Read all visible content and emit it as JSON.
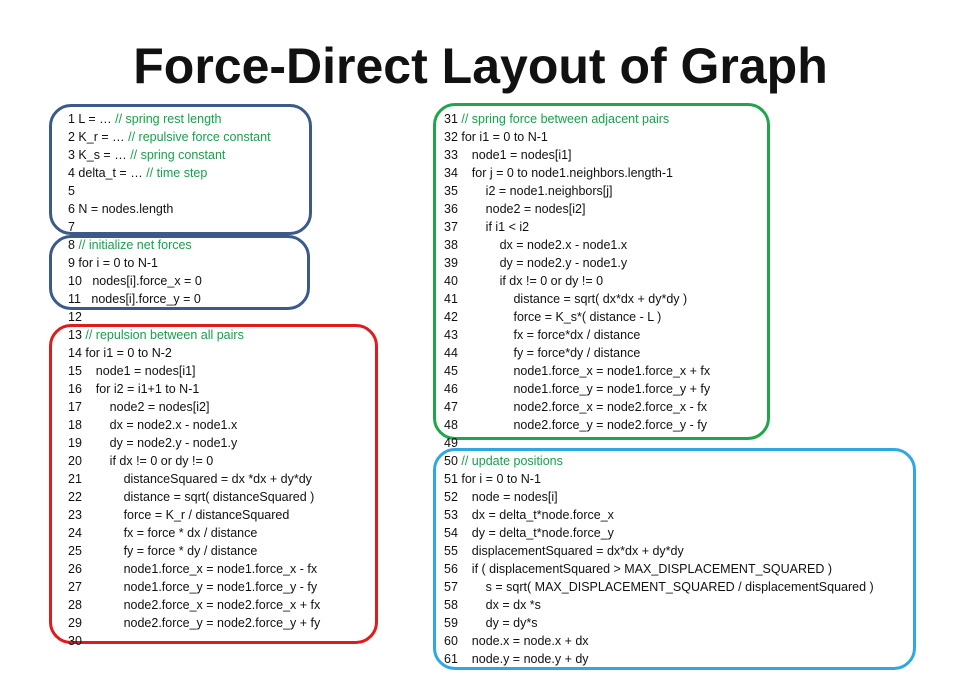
{
  "page": {
    "title": "Force-Direct Layout of Graph"
  },
  "colors": {
    "comment": "#1aa04a",
    "box_constants": "#3b5a8a",
    "box_init": "#3b5a8a",
    "box_repulsion": "#e01b1b",
    "box_spring": "#1fa54a",
    "box_update": "#2fa8df"
  },
  "left_column": {
    "lines": [
      {
        "code": "1 L = … ",
        "comment": "// spring rest length"
      },
      {
        "code": "2 K_r = … ",
        "comment": "// repulsive force constant"
      },
      {
        "code": "3 K_s = … ",
        "comment": "// spring constant"
      },
      {
        "code": "4 delta_t = … ",
        "comment": "// time step"
      },
      {
        "code": "5",
        "comment": ""
      },
      {
        "code": "6 N = nodes.length",
        "comment": ""
      },
      {
        "code": "7",
        "comment": ""
      },
      {
        "code": "8 ",
        "comment": "// initialize net forces"
      },
      {
        "code": "9 for i = 0 to N-1",
        "comment": ""
      },
      {
        "code": "10   nodes[i].force_x = 0",
        "comment": ""
      },
      {
        "code": "11   nodes[i].force_y = 0",
        "comment": ""
      },
      {
        "code": "12",
        "comment": ""
      },
      {
        "code": "13 ",
        "comment": "// repulsion between all pairs"
      },
      {
        "code": "14 for i1 = 0 to N-2",
        "comment": ""
      },
      {
        "code": "15    node1 = nodes[i1]",
        "comment": ""
      },
      {
        "code": "16    for i2 = i1+1 to N-1",
        "comment": ""
      },
      {
        "code": "17        node2 = nodes[i2]",
        "comment": ""
      },
      {
        "code": "18        dx = node2.x - node1.x",
        "comment": ""
      },
      {
        "code": "19        dy = node2.y - node1.y",
        "comment": ""
      },
      {
        "code": "20        if dx != 0 or dy != 0",
        "comment": ""
      },
      {
        "code": "21            distanceSquared = dx *dx + dy*dy",
        "comment": ""
      },
      {
        "code": "22            distance = sqrt( distanceSquared )",
        "comment": ""
      },
      {
        "code": "23            force = K_r / distanceSquared",
        "comment": ""
      },
      {
        "code": "24            fx = force * dx / distance",
        "comment": ""
      },
      {
        "code": "25            fy = force * dy / distance",
        "comment": ""
      },
      {
        "code": "26            node1.force_x = node1.force_x - fx",
        "comment": ""
      },
      {
        "code": "27            node1.force_y = node1.force_y - fy",
        "comment": ""
      },
      {
        "code": "28            node2.force_x = node2.force_x + fx",
        "comment": ""
      },
      {
        "code": "29            node2.force_y = node2.force_y + fy",
        "comment": ""
      },
      {
        "code": "30",
        "comment": ""
      }
    ]
  },
  "right_column": {
    "lines": [
      {
        "code": "31 ",
        "comment": "// spring force between adjacent pairs"
      },
      {
        "code": "32 for i1 = 0 to N-1",
        "comment": ""
      },
      {
        "code": "33    node1 = nodes[i1]",
        "comment": ""
      },
      {
        "code": "34    for j = 0 to node1.neighbors.length-1",
        "comment": ""
      },
      {
        "code": "35        i2 = node1.neighbors[j]",
        "comment": ""
      },
      {
        "code": "36        node2 = nodes[i2]",
        "comment": ""
      },
      {
        "code": "37        if i1 < i2",
        "comment": ""
      },
      {
        "code": "38            dx = node2.x - node1.x",
        "comment": ""
      },
      {
        "code": "39            dy = node2.y - node1.y",
        "comment": ""
      },
      {
        "code": "40            if dx != 0 or dy != 0",
        "comment": ""
      },
      {
        "code": "41                distance = sqrt( dx*dx + dy*dy )",
        "comment": ""
      },
      {
        "code": "42                force = K_s*( distance - L )",
        "comment": ""
      },
      {
        "code": "43                fx = force*dx / distance",
        "comment": ""
      },
      {
        "code": "44                fy = force*dy / distance",
        "comment": ""
      },
      {
        "code": "45                node1.force_x = node1.force_x + fx",
        "comment": ""
      },
      {
        "code": "46                node1.force_y = node1.force_y + fy",
        "comment": ""
      },
      {
        "code": "47                node2.force_x = node2.force_x - fx",
        "comment": ""
      },
      {
        "code": "48                node2.force_y = node2.force_y - fy",
        "comment": ""
      },
      {
        "code": "49",
        "comment": ""
      },
      {
        "code": "50 ",
        "comment": "// update positions"
      },
      {
        "code": "51 for i = 0 to N-1",
        "comment": ""
      },
      {
        "code": "52    node = nodes[i]",
        "comment": ""
      },
      {
        "code": "53    dx = delta_t*node.force_x",
        "comment": ""
      },
      {
        "code": "54    dy = delta_t*node.force_y",
        "comment": ""
      },
      {
        "code": "55    displacementSquared = dx*dx + dy*dy",
        "comment": ""
      },
      {
        "code": "56    if ( displacementSquared > MAX_DISPLACEMENT_SQUARED )",
        "comment": ""
      },
      {
        "code": "57        s = sqrt( MAX_DISPLACEMENT_SQUARED / displacementSquared )",
        "comment": ""
      },
      {
        "code": "58        dx = dx *s",
        "comment": ""
      },
      {
        "code": "59        dy = dy*s",
        "comment": ""
      },
      {
        "code": "60    node.x = node.x + dx",
        "comment": ""
      },
      {
        "code": "61    node.y = node.y + dy",
        "comment": ""
      }
    ]
  }
}
